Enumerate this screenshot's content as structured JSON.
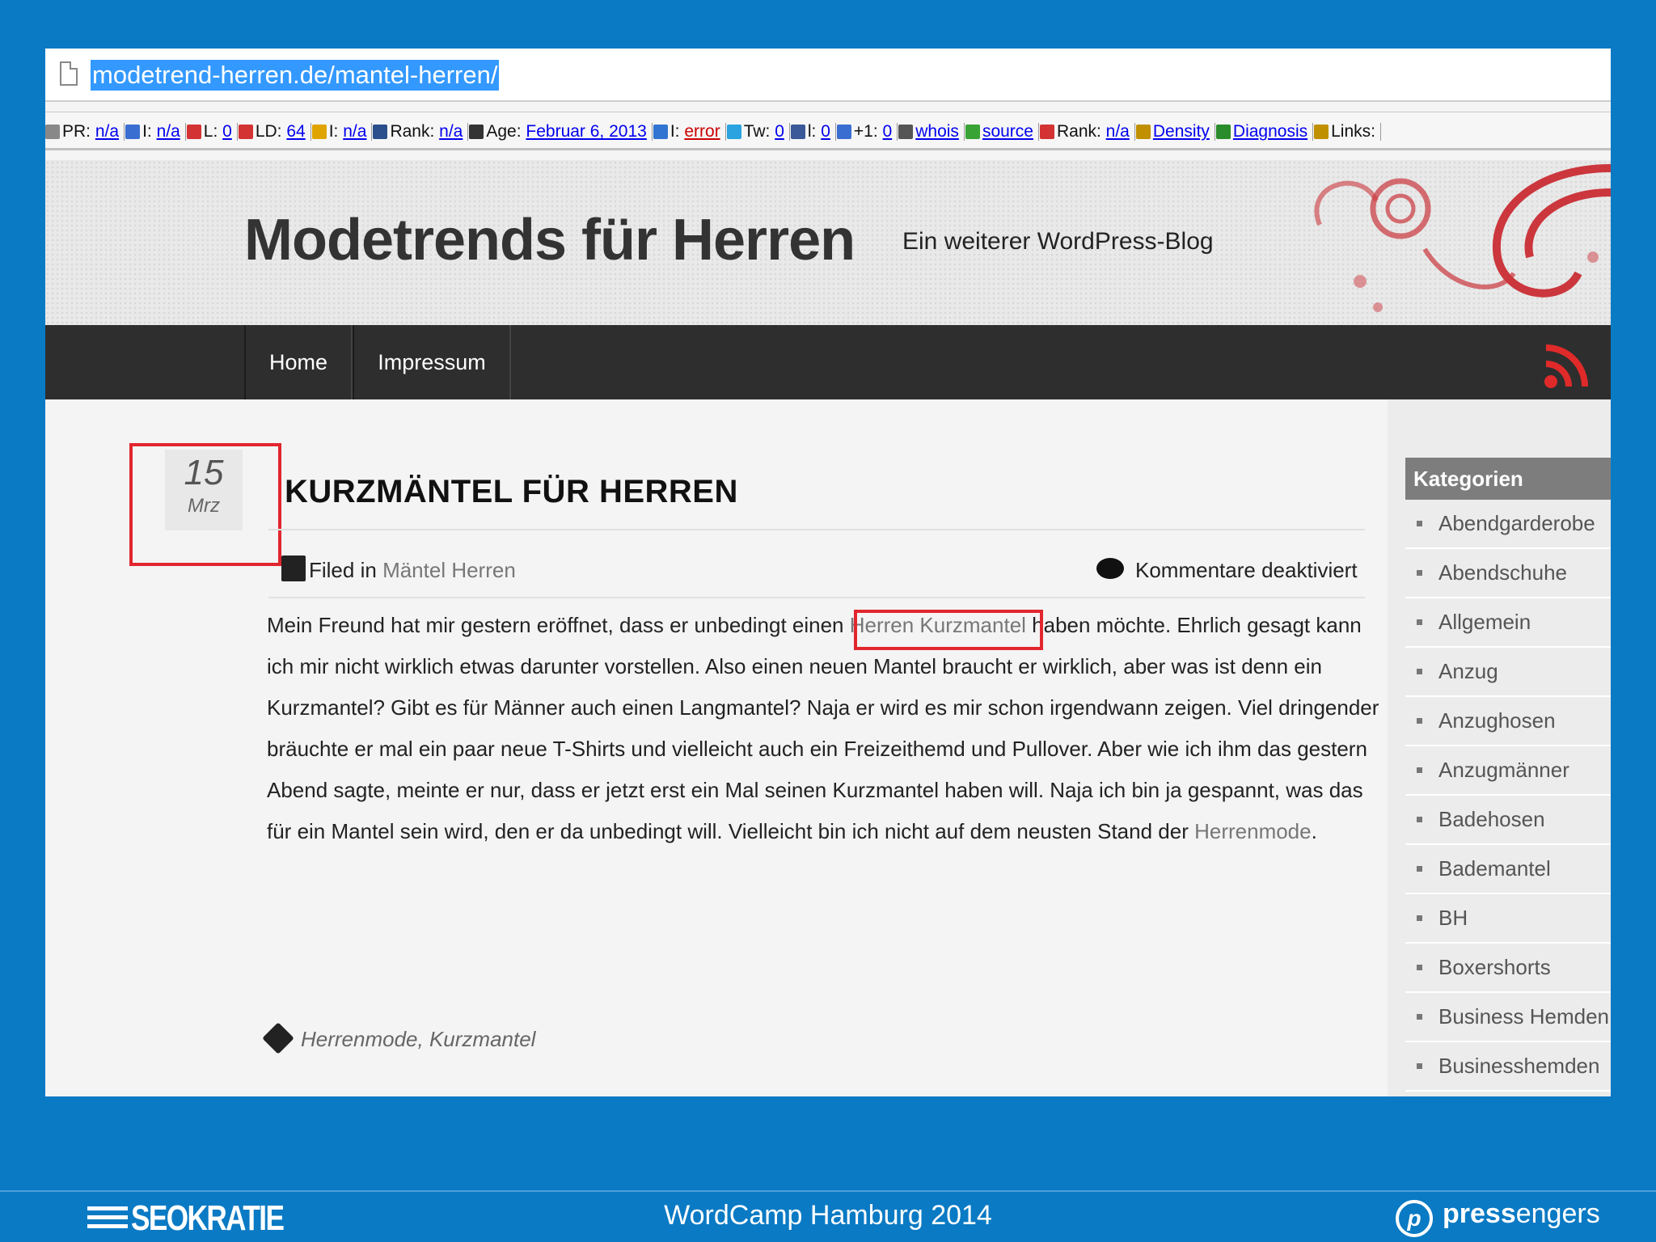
{
  "browser": {
    "url": "modetrend-herren.de/mantel-herren/"
  },
  "seo_toolbar": {
    "items": [
      {
        "label": "PR:",
        "value": "n/a",
        "icon": "pagerank-icon",
        "color": "#888888"
      },
      {
        "label": "I:",
        "value": "n/a",
        "icon": "google-index-icon",
        "color": "#3b6ed1"
      },
      {
        "label": "L:",
        "value": "0",
        "icon": "links-icon",
        "color": "#d33333"
      },
      {
        "label": "LD:",
        "value": "64",
        "icon": "link-domains-icon",
        "color": "#d33333"
      },
      {
        "label": "I:",
        "value": "n/a",
        "icon": "bing-index-icon",
        "color": "#e0a400"
      },
      {
        "label": "Rank:",
        "value": "n/a",
        "icon": "alexa-rank-icon",
        "color": "#2a4f8c"
      },
      {
        "label": "Age:",
        "value": "Februar 6, 2013",
        "icon": "archive-age-icon",
        "color": "#333333"
      },
      {
        "label": "I:",
        "value": "error",
        "icon": "delicious-icon",
        "color": "#3274d1"
      },
      {
        "label": "Tw:",
        "value": "0",
        "icon": "twitter-icon",
        "color": "#2aa3e0"
      },
      {
        "label": "l:",
        "value": "0",
        "icon": "facebook-icon",
        "color": "#3b5998"
      },
      {
        "label": "+1:",
        "value": "0",
        "icon": "google-plus-icon",
        "color": "#3b6ed1"
      },
      {
        "label": "",
        "value": "whois",
        "icon": "whois-icon",
        "color": "#555555"
      },
      {
        "label": "",
        "value": "source",
        "icon": "source-icon",
        "color": "#3aa335"
      },
      {
        "label": "Rank:",
        "value": "n/a",
        "icon": "rank-icon",
        "color": "#d33333"
      },
      {
        "label": "",
        "value": "Density",
        "icon": "density-icon",
        "color": "#c09000"
      },
      {
        "label": "",
        "value": "Diagnosis",
        "icon": "diagnosis-icon",
        "color": "#2a8c2a"
      },
      {
        "label": "Links:",
        "value": "",
        "icon": "links-gear-icon",
        "color": "#c09000"
      }
    ]
  },
  "site": {
    "title": "Modetrends für Herren",
    "tagline": "Ein weiterer WordPress-Blog"
  },
  "nav": {
    "items": [
      "Home",
      "Impressum"
    ]
  },
  "post": {
    "date_day": "15",
    "date_month": "Mrz",
    "title": "KURZMÄNTEL FÜR HERREN",
    "filed_in_label": "Filed in",
    "category": "Mäntel Herren",
    "comments": "Kommentare deaktiviert",
    "body_part1": "Mein Freund hat mir gestern eröffnet, dass er unbedingt einen ",
    "body_link1": "Herren Kurzmantel",
    "body_part2": " haben möchte. Ehrlich gesagt kann ich mir nicht wirklich etwas darunter vorstellen. Also einen neuen Mantel braucht er wirklich, aber was ist denn ein Kurzmantel? Gibt es für Männer auch einen Langmantel?  Naja er wird es mir schon irgendwann zeigen. Viel dringender bräuchte er mal ein paar neue T-Shirts und vielleicht auch ein Freizeithemd und Pullover. Aber wie ich ihm das gestern Abend sagte, meinte er nur, dass er jetzt erst ein Mal seinen Kurzmantel haben will. Naja ich bin ja gespannt, was das für ein Mantel sein wird, den er da unbedingt will. Vielleicht bin ich nicht auf dem neusten Stand der ",
    "body_link2": "Herrenmode",
    "body_part3": ".",
    "tags": "Herrenmode, Kurzmantel"
  },
  "sidebar": {
    "heading": "Kategorien",
    "items": [
      "Abendgarderobe",
      "Abendschuhe",
      "Allgemein",
      "Anzug",
      "Anzughosen",
      "Anzugmänner",
      "Badehosen",
      "Bademantel",
      "BH",
      "Boxershorts",
      "Business Hemden",
      "Businesshemden"
    ]
  },
  "footer": {
    "event": "WordCamp Hamburg 2014",
    "left_logo": "SEOKRATIE",
    "right_logo_bold": "press",
    "right_logo_light": "engers",
    "right_logo_mark": "p"
  },
  "colors": {
    "frame_blue": "#0a7ac4",
    "highlight_red": "#e2262e",
    "nav_dark": "#2e2e2e",
    "url_selection": "#3399ff"
  }
}
